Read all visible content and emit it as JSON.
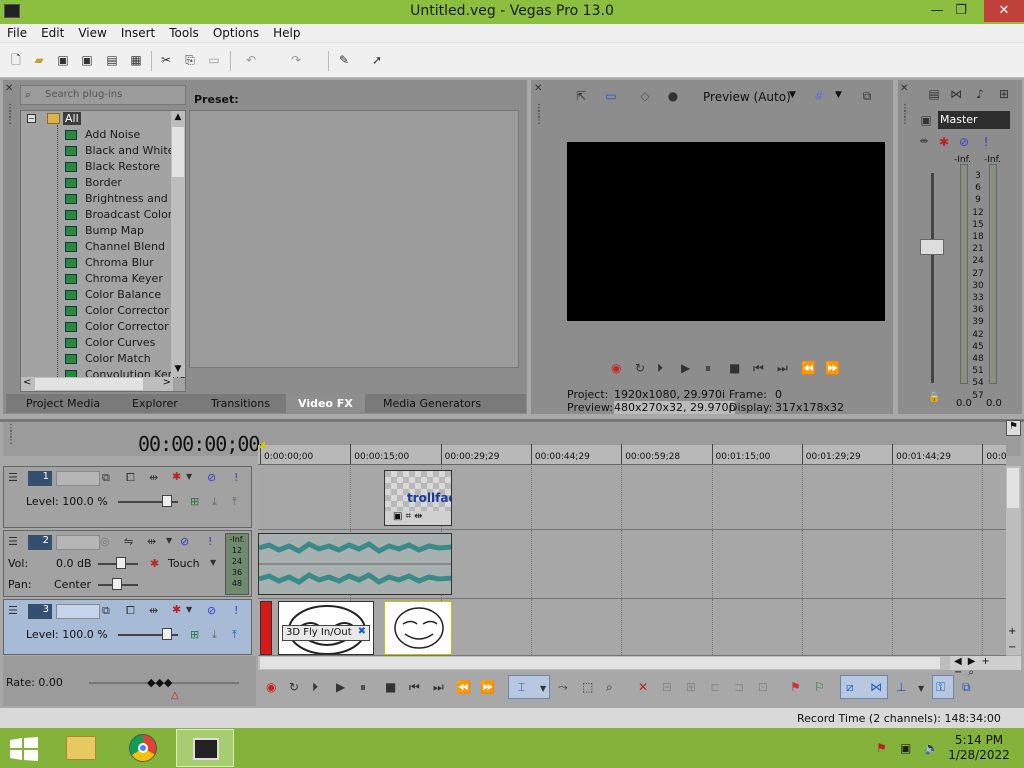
{
  "window": {
    "title": "Untitled.veg - Vegas Pro 13.0",
    "minimize": "—",
    "restore": "❐",
    "close": "✕"
  },
  "menu": [
    "File",
    "Edit",
    "View",
    "Insert",
    "Tools",
    "Options",
    "Help"
  ],
  "plugins": {
    "search_placeholder": "Search plug-ins",
    "root": "All",
    "items": [
      "Add Noise",
      "Black and White",
      "Black Restore",
      "Border",
      "Brightness and Co",
      "Broadcast Colors",
      "Bump Map",
      "Channel Blend",
      "Chroma Blur",
      "Chroma Keyer",
      "Color Balance",
      "Color Corrector",
      "Color Corrector (S",
      "Color Curves",
      "Color Match",
      "Convolution Kerne"
    ],
    "preset_label": "Preset:"
  },
  "window_tabs": [
    "Project Media",
    "Explorer",
    "Transitions",
    "Video FX",
    "Media Generators"
  ],
  "active_tab": "Video FX",
  "preview": {
    "mode": "Preview (Auto)",
    "project_label": "Project:",
    "project_value": "1920x1080, 29.970i",
    "preview_label": "Preview:",
    "preview_value": "480x270x32, 29.970p",
    "frame_label": "Frame:",
    "frame_value": "0",
    "display_label": "Display:",
    "display_value": "317x178x32"
  },
  "master": {
    "label": "Master",
    "left_peak": "-Inf.",
    "right_peak": "-Inf.",
    "scale": [
      "3",
      "6",
      "9",
      "12",
      "15",
      "18",
      "21",
      "24",
      "27",
      "30",
      "33",
      "36",
      "39",
      "42",
      "45",
      "48",
      "51",
      "54",
      "57"
    ],
    "left_db": "0.0",
    "right_db": "0.0"
  },
  "timeline": {
    "timecode": "00:00:00;00",
    "ruler": [
      "0:00:00;00",
      "00:00:15;00",
      "00:00:29;29",
      "00:00:44;29",
      "00:00:59;28",
      "00:01:15;00",
      "00:01:29;29",
      "00:01:44;29",
      "00:0"
    ],
    "tracks": [
      {
        "num": "1",
        "level": "Level: 100.0 %"
      },
      {
        "num": "2",
        "vol_label": "Vol:",
        "vol": "0.0 dB",
        "pan_label": "Pan:",
        "pan": "Center",
        "mode": "Touch",
        "meter_top": "-Inf.",
        "meter": [
          "12",
          "24",
          "36",
          "48"
        ]
      },
      {
        "num": "3",
        "level": "Level: 100.0 %"
      }
    ],
    "clip1_text": "trollfac",
    "transition_label": "3D Fly In/Out"
  },
  "rate": "Rate: 0.00",
  "status": "Record Time (2 channels): 148:34:00",
  "clock": {
    "time": "5:14 PM",
    "date": "1/28/2022"
  }
}
